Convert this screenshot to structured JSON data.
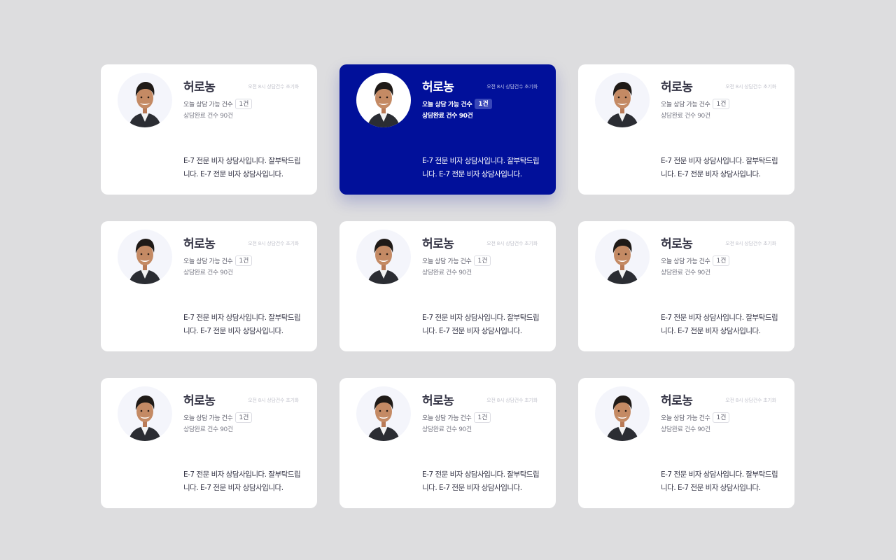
{
  "colors": {
    "background": "#dddddf",
    "card": "#ffffff",
    "selected_card": "#01109a",
    "text_primary": "#333344",
    "text_muted": "#c2c3cc"
  },
  "cards": [
    {
      "name": "허로농",
      "reset_note": "오전 8시 상담건수 초기화",
      "available_label": "오늘 상담 가능 건수",
      "available_count": "1건",
      "completed": "상담완료 건수 90건",
      "description": "E-7 전문 비자 상담사입니다. 잘부탁드립니다. E-7 전문 비자 상담사입니다.",
      "selected": false,
      "avatar_icon": "person-portrait"
    },
    {
      "name": "허로농",
      "reset_note": "오전 8시 상담건수 초기화",
      "available_label": "오늘 상담 가능 건수",
      "available_count": "1건",
      "completed": "상담완료 건수 90건",
      "description": "E-7 전문 비자 상담사입니다. 잘부탁드립니다. E-7 전문 비자 상담사입니다.",
      "selected": true,
      "avatar_icon": "person-portrait"
    },
    {
      "name": "허로농",
      "reset_note": "오전 8시 상담건수 초기화",
      "available_label": "오늘 상담 가능 건수",
      "available_count": "1건",
      "completed": "상담완료 건수 90건",
      "description": "E-7 전문 비자 상담사입니다. 잘부탁드립니다. E-7 전문 비자 상담사입니다.",
      "selected": false,
      "avatar_icon": "person-portrait"
    },
    {
      "name": "허로농",
      "reset_note": "오전 8시 상담건수 초기화",
      "available_label": "오늘 상담 가능 건수",
      "available_count": "1건",
      "completed": "상담완료 건수 90건",
      "description": "E-7 전문 비자 상담사입니다. 잘부탁드립니다. E-7 전문 비자 상담사입니다.",
      "selected": false,
      "avatar_icon": "person-portrait"
    },
    {
      "name": "허로농",
      "reset_note": "오전 8시 상담건수 초기화",
      "available_label": "오늘 상담 가능 건수",
      "available_count": "1건",
      "completed": "상담완료 건수 90건",
      "description": "E-7 전문 비자 상담사입니다. 잘부탁드립니다. E-7 전문 비자 상담사입니다.",
      "selected": false,
      "avatar_icon": "person-portrait"
    },
    {
      "name": "허로농",
      "reset_note": "오전 8시 상담건수 초기화",
      "available_label": "오늘 상담 가능 건수",
      "available_count": "1건",
      "completed": "상담완료 건수 90건",
      "description": "E-7 전문 비자 상담사입니다. 잘부탁드립니다. E-7 전문 비자 상담사입니다.",
      "selected": false,
      "avatar_icon": "person-portrait"
    },
    {
      "name": "허로농",
      "reset_note": "오전 8시 상담건수 초기화",
      "available_label": "오늘 상담 가능 건수",
      "available_count": "1건",
      "completed": "상담완료 건수 90건",
      "description": "E-7 전문 비자 상담사입니다. 잘부탁드립니다. E-7 전문 비자 상담사입니다.",
      "selected": false,
      "avatar_icon": "person-portrait"
    },
    {
      "name": "허로농",
      "reset_note": "오전 8시 상담건수 초기화",
      "available_label": "오늘 상담 가능 건수",
      "available_count": "1건",
      "completed": "상담완료 건수 90건",
      "description": "E-7 전문 비자 상담사입니다. 잘부탁드립니다. E-7 전문 비자 상담사입니다.",
      "selected": false,
      "avatar_icon": "person-portrait"
    },
    {
      "name": "허로농",
      "reset_note": "오전 8시 상담건수 초기화",
      "available_label": "오늘 상담 가능 건수",
      "available_count": "1건",
      "completed": "상담완료 건수 90건",
      "description": "E-7 전문 비자 상담사입니다. 잘부탁드립니다. E-7 전문 비자 상담사입니다.",
      "selected": false,
      "avatar_icon": "person-portrait"
    }
  ]
}
